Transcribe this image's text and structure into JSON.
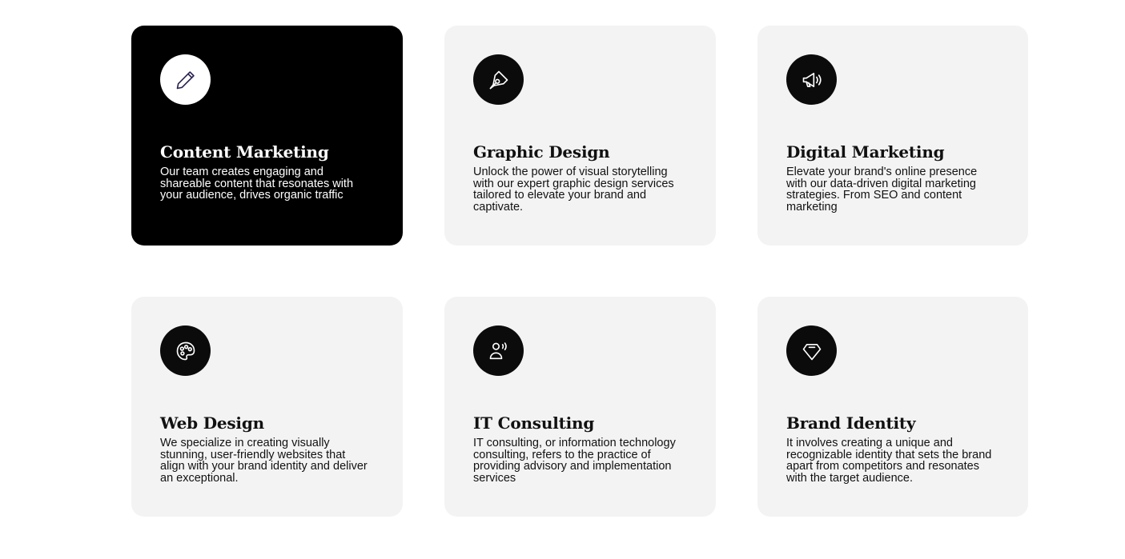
{
  "services": [
    {
      "title": "Content Marketing",
      "description": "Our team creates engaging and shareable content that resonates with your audience, drives organic traffic",
      "icon": "pencil-icon",
      "active": true
    },
    {
      "title": "Graphic Design",
      "description": "Unlock the power of visual storytelling with our expert graphic design services tailored to elevate your brand and captivate.",
      "icon": "pen-tool-icon",
      "active": false
    },
    {
      "title": "Digital Marketing",
      "description": "Elevate your brand's online presence with our data-driven digital marketing strategies. From SEO and content marketing",
      "icon": "megaphone-icon",
      "active": false
    },
    {
      "title": "Web Design",
      "description": "We specialize in creating visually stunning, user-friendly websites that align with your brand identity and deliver an exceptional.",
      "icon": "palette-icon",
      "active": false
    },
    {
      "title": "IT Consulting",
      "description": "IT consulting, or information technology consulting, refers to the practice of providing advisory and implementation services",
      "icon": "user-voice-icon",
      "active": false
    },
    {
      "title": "Brand Identity",
      "description": "It involves creating a unique and recognizable identity that sets the brand apart from competitors and resonates with the target audience.",
      "icon": "diamond-icon",
      "active": false
    }
  ],
  "colors": {
    "active_card_bg": "#000000",
    "card_bg": "#f3f3f3",
    "icon_circle": "#0b0b0b",
    "active_icon_stroke": "#2a2350"
  }
}
